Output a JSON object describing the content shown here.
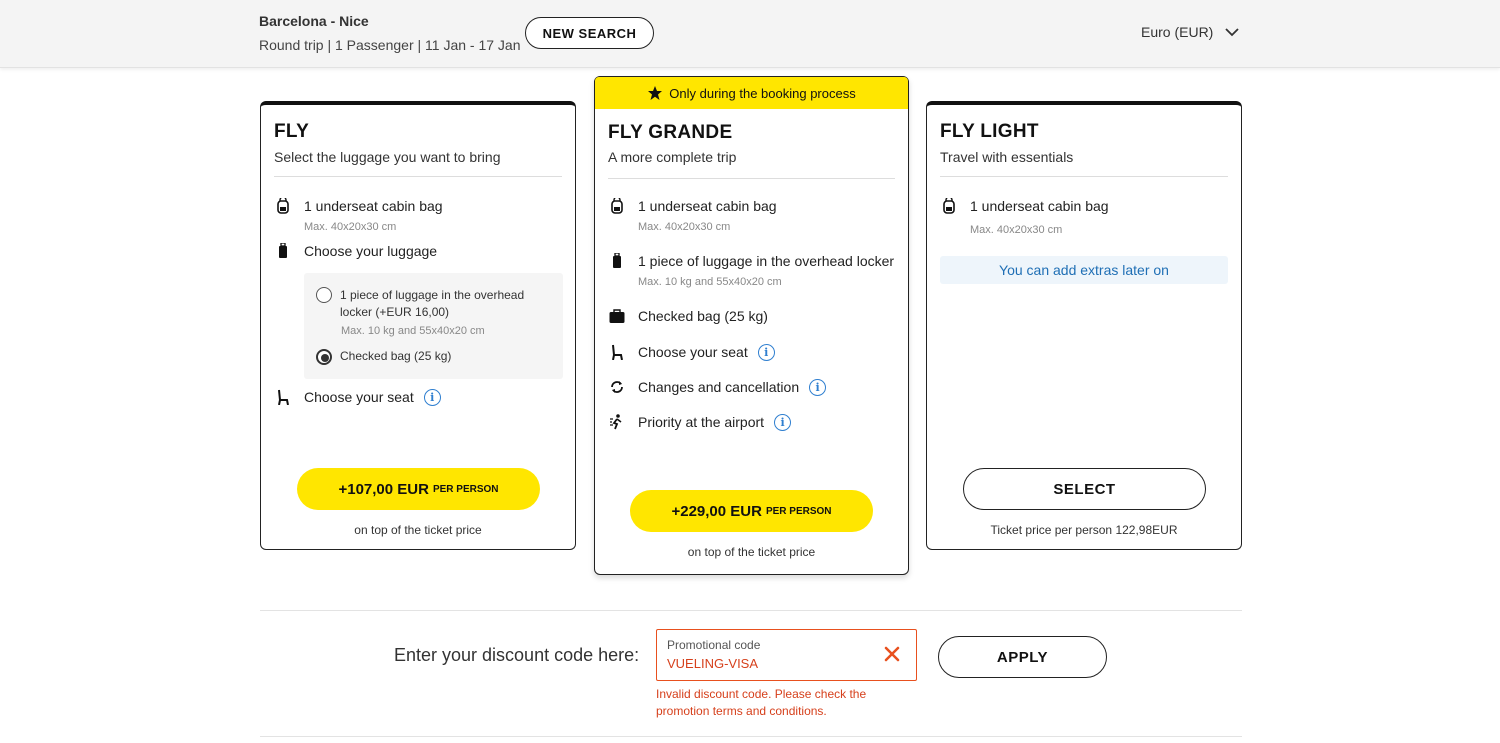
{
  "header": {
    "route": "Barcelona - Nice",
    "trip_info": "Round trip | 1 Passenger | 11 Jan - 17 Jan",
    "new_search_label": "NEW SEARCH",
    "currency": "Euro (EUR)"
  },
  "cards": {
    "fly": {
      "title": "FLY",
      "subtitle": "Select the luggage you want to bring",
      "cabin_bag": "1 underseat cabin bag",
      "cabin_bag_note": "Max. 40x20x30 cm",
      "choose_luggage": "Choose your luggage",
      "option_overhead": "1 piece of luggage in the overhead locker (+EUR 16,00)",
      "option_overhead_note": "Max. 10 kg and 55x40x20 cm",
      "option_checked": "Checked bag (25 kg)",
      "selected_option": "Checked bag (25 kg)",
      "choose_seat": "Choose your seat",
      "price": "+107,00 EUR",
      "per_person": "PER PERSON",
      "on_top": "on top of the ticket price"
    },
    "grande": {
      "banner": "Only during the booking process",
      "title": "FLY GRANDE",
      "subtitle": "A more complete trip",
      "cabin_bag": "1 underseat cabin bag",
      "cabin_bag_note": "Max. 40x20x30 cm",
      "overhead": "1 piece of luggage in the overhead locker",
      "overhead_note": "Max. 10 kg and 55x40x20 cm",
      "checked": "Checked bag (25 kg)",
      "choose_seat": "Choose your seat",
      "changes": "Changes and cancellation",
      "priority": "Priority at the airport",
      "price": "+229,00 EUR",
      "per_person": "PER PERSON",
      "on_top": "on top of the ticket price"
    },
    "light": {
      "title": "FLY LIGHT",
      "subtitle": "Travel with essentials",
      "cabin_bag": "1 underseat cabin bag",
      "cabin_bag_note": "Max. 40x20x30 cm",
      "extras": "You can add extras later on",
      "select_label": "SELECT",
      "ticket_price": "Ticket price per person 122,98EUR"
    }
  },
  "discount": {
    "label": "Enter your discount code here:",
    "field_label": "Promotional code",
    "field_value": "VUELING-VISA",
    "error": "Invalid discount code. Please check the promotion terms and conditions.",
    "apply_label": "APPLY"
  },
  "info_glyph": "i",
  "colors": {
    "brand_yellow": "#ffe600",
    "error": "#d6401c",
    "info_blue": "#2f7fd0"
  },
  "icons": [
    "backpack-icon",
    "suitcase-icon",
    "seat-icon",
    "info-icon",
    "star-icon",
    "bag-icon",
    "changes-icon",
    "priority-icon",
    "chevron-down-icon",
    "close-icon"
  ]
}
